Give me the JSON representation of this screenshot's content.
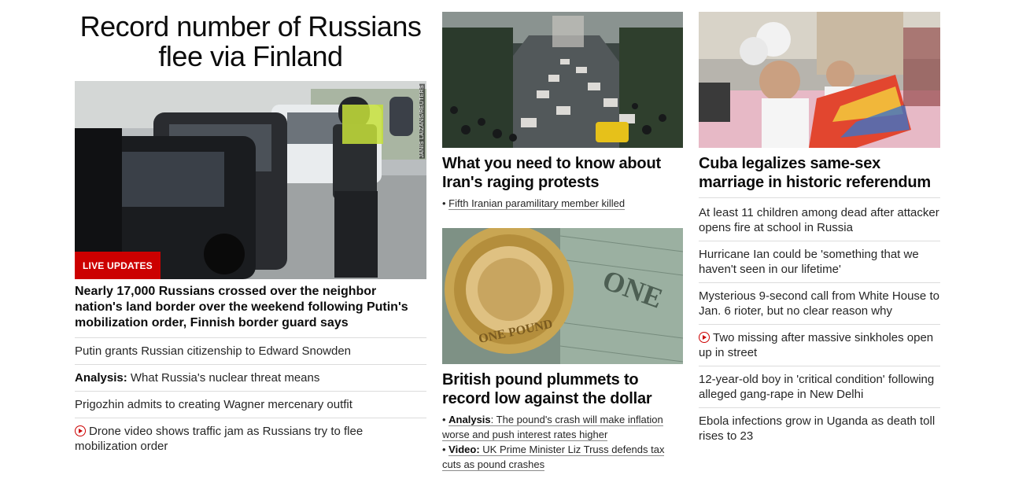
{
  "col1": {
    "title": "Record number of Russians flee via Finland",
    "photo_credit": "JANIS LAIZANS/REUTERS",
    "live_badge": "LIVE UPDATES",
    "lead_headline": "Nearly 17,000 Russians crossed over the neighbor nation's land border over the weekend following Putin's mobilization order, Finnish border guard says",
    "links": [
      {
        "prefix": "",
        "text": "Putin grants Russian citizenship to Edward Snowden",
        "video": false
      },
      {
        "prefix": "Analysis:",
        "text": " What Russia's nuclear threat means",
        "video": false
      },
      {
        "prefix": "",
        "text": "Prigozhin admits to creating Wagner mercenary outfit",
        "video": false
      },
      {
        "prefix": "",
        "text": "Drone video shows traffic jam as Russians try to flee mobilization order",
        "video": true
      }
    ]
  },
  "col2": {
    "card1": {
      "headline": "What you need to know about Iran's raging protests",
      "bullet": "Fifth Iranian paramilitary member killed"
    },
    "card2": {
      "headline": "British pound plummets to record low against the dollar",
      "bullets": [
        {
          "label": "Analysis",
          "sep": ":",
          "text": " The pound's crash will make inflation worse and push interest rates higher"
        },
        {
          "label": "Video:",
          "sep": "",
          "text": " UK Prime Minister Liz Truss defends tax cuts as pound crashes"
        }
      ]
    }
  },
  "col3": {
    "headline": "Cuba legalizes same-sex marriage in historic referendum",
    "links": [
      {
        "text": "At least 11 children among dead after attacker opens fire at school in Russia",
        "video": false
      },
      {
        "text": "Hurricane Ian could be 'something that we haven't seen in our lifetime'",
        "video": false
      },
      {
        "text": "Mysterious 9-second call from White House to Jan. 6 rioter, but no clear reason why",
        "video": false
      },
      {
        "text": "Two missing after massive sinkholes open up in street",
        "video": true
      },
      {
        "text": "12-year-old boy in 'critical condition' following alleged gang-rape in New Delhi",
        "video": false
      },
      {
        "text": "Ebola infections grow in Uganda as death toll rises to 23",
        "video": false
      }
    ]
  },
  "colors": {
    "accent_red": "#cc0000",
    "divider": "#dcdcdc",
    "text": "#0c0c0c"
  }
}
